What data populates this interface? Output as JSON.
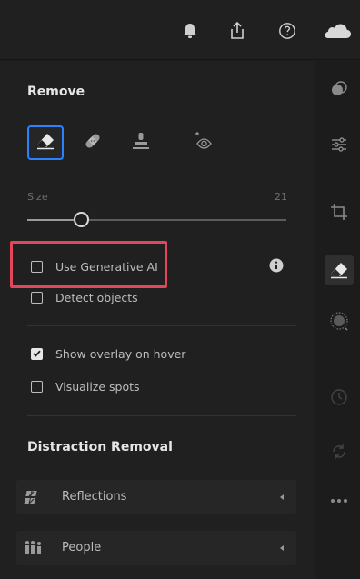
{
  "panel": {
    "title": "Remove",
    "size_slider": {
      "label": "Size",
      "value": 21,
      "min": 0,
      "max": 100
    },
    "options": [
      {
        "label": "Use Generative AI",
        "checked": false
      },
      {
        "label": "Detect objects",
        "checked": false
      },
      {
        "label": "Show overlay on hover",
        "checked": true
      },
      {
        "label": "Visualize spots",
        "checked": false
      }
    ],
    "distraction_title": "Distraction Removal",
    "distraction_items": [
      {
        "label": "Reflections",
        "icon": "reflections-icon"
      },
      {
        "label": "People",
        "icon": "people-icon"
      }
    ]
  },
  "toolbar": {
    "icons": [
      "bell-icon",
      "share-icon",
      "help-icon",
      "cloud-icon"
    ]
  },
  "tools": [
    "remove-eraser-icon",
    "heal-bandage-icon",
    "clone-stamp-icon",
    "red-eye-icon"
  ],
  "rail": {
    "icons": [
      "presets-icon",
      "edit-sliders-icon",
      "crop-icon",
      "eraser-icon",
      "masking-icon",
      "history-icon",
      "versions-icon",
      "more-icon"
    ],
    "active": "eraser-icon"
  },
  "colors": {
    "accent": "#2b82ff",
    "highlight": "#e3455c",
    "panel_bg": "#202020"
  }
}
